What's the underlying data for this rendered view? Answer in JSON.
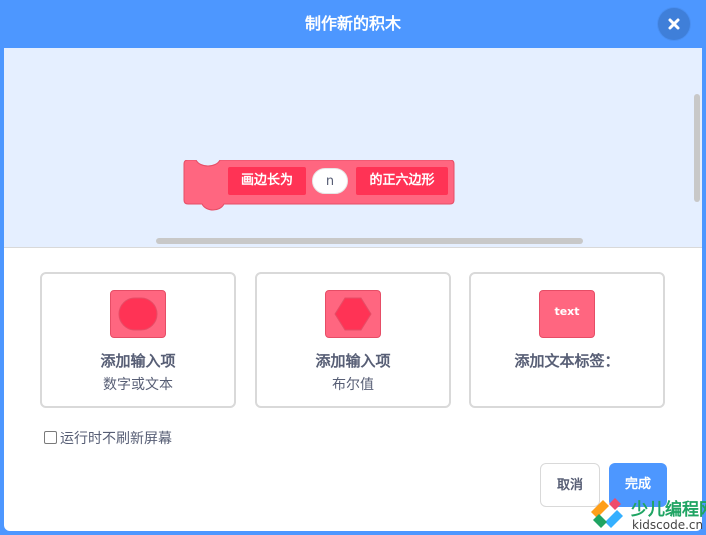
{
  "header": {
    "title": "制作新的积木"
  },
  "block": {
    "label_1": "画边长为",
    "input_value": "n",
    "label_2": "的正六边形",
    "color": "#ff6680",
    "stroke": "#e64d66"
  },
  "options": [
    {
      "title": "添加输入项",
      "subtitle": "数字或文本",
      "icon": "number-text-input-icon"
    },
    {
      "title": "添加输入项",
      "subtitle": "布尔值",
      "icon": "boolean-input-icon"
    },
    {
      "title": "添加文本标签：",
      "subtitle": "",
      "icon": "text-label-icon",
      "icon_text": "text"
    }
  ],
  "checkbox": {
    "label": "运行时不刷新屏幕",
    "checked": false
  },
  "buttons": {
    "cancel": "取消",
    "ok": "完成"
  },
  "watermark": {
    "name": "少儿编程网",
    "url": "kidscode.cn"
  },
  "colors": {
    "accent": "#4d97ff",
    "block": "#ff6680",
    "workspace": "#e5efff",
    "text": "#575e75"
  }
}
